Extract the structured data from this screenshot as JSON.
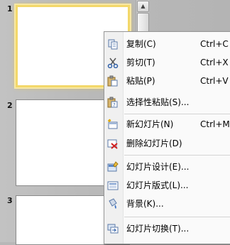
{
  "slides": [
    {
      "number": "1"
    },
    {
      "number": "2"
    },
    {
      "number": "3"
    }
  ],
  "context_menu": {
    "items": [
      {
        "label": "复制(C)",
        "shortcut": "Ctrl+C",
        "icon": "copy-icon"
      },
      {
        "label": "剪切(T)",
        "shortcut": "Ctrl+X",
        "icon": "scissors-icon"
      },
      {
        "label": "粘贴(P)",
        "shortcut": "Ctrl+V",
        "icon": "paste-icon"
      },
      {
        "label": "选择性粘贴(S)...",
        "shortcut": "",
        "icon": "paste-special-icon"
      },
      {
        "label": "新幻灯片(N)",
        "shortcut": "Ctrl+M",
        "icon": "new-slide-icon"
      },
      {
        "label": "删除幻灯片(D)",
        "shortcut": "",
        "icon": "delete-slide-icon"
      },
      {
        "label": "幻灯片设计(E)...",
        "shortcut": "",
        "icon": "slide-design-icon"
      },
      {
        "label": "幻灯片版式(L)...",
        "shortcut": "",
        "icon": "slide-layout-icon"
      },
      {
        "label": "背景(K)...",
        "shortcut": "",
        "icon": "background-icon"
      },
      {
        "label": "幻灯片切换(T)...",
        "shortcut": "",
        "icon": "slide-transition-icon"
      }
    ]
  }
}
